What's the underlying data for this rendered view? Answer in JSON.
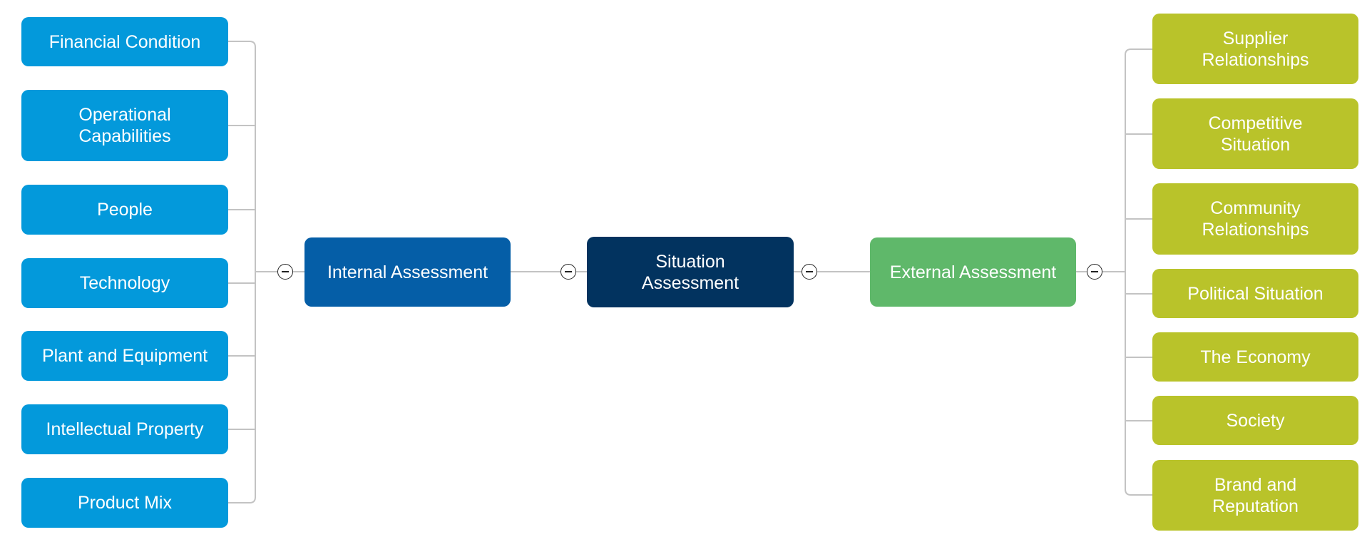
{
  "colors": {
    "internal_children": "#0399db",
    "internal": "#055ea7",
    "root": "#02335f",
    "external": "#5fb86a",
    "external_children": "#b9c32a",
    "connector": "#c3c3c3"
  },
  "root": {
    "label": "Situation\nAssessment",
    "toggle_icon": "collapse-minus-icon"
  },
  "internal": {
    "label": "Internal Assessment",
    "toggle_icon": "collapse-minus-icon",
    "children": [
      "Financial Condition",
      "Operational\nCapabilities",
      "People",
      "Technology",
      "Plant and Equipment",
      "Intellectual Property",
      "Product Mix"
    ]
  },
  "external": {
    "label": "External Assessment",
    "toggle_icon": "collapse-minus-icon",
    "children": [
      "Supplier\nRelationships",
      "Competitive\nSituation",
      "Community\nRelationships",
      "Political Situation",
      "The Economy",
      "Society",
      "Brand and\nReputation"
    ]
  }
}
